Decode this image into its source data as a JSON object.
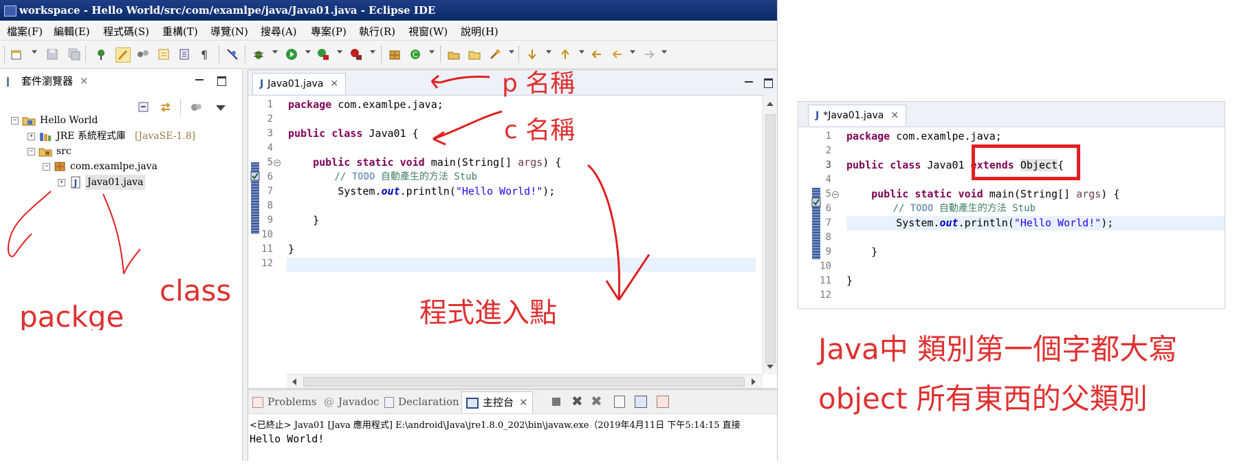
{
  "window": {
    "title": "workspace - Hello World/src/com/examlpe/java/Java01.java - Eclipse IDE"
  },
  "menu": [
    "檔案(F)",
    "編輯(E)",
    "程式碼(S)",
    "重構(T)",
    "導覽(N)",
    "搜尋(A)",
    "專案(P)",
    "執行(R)",
    "視窗(W)",
    "說明(H)"
  ],
  "package_explorer": {
    "title": "套件瀏覽器",
    "tree": [
      {
        "label": "Hello World",
        "suffix": ""
      },
      {
        "label": "JRE 系統程式庫",
        "suffix": "[JavaSE-1.8]"
      },
      {
        "label": "src",
        "suffix": ""
      },
      {
        "label": "com.examlpe.java",
        "suffix": ""
      },
      {
        "label": "Java01.java",
        "suffix": ""
      }
    ]
  },
  "editor": {
    "tab_label": "Java01.java",
    "line_numbers": [
      "1",
      "2",
      "3",
      "4",
      "5",
      "6",
      "7",
      "8",
      "9",
      "10",
      "11",
      "12"
    ],
    "line1": {
      "kw": "package",
      "rest": " com.examlpe.java;"
    },
    "line3": {
      "kw1": "public",
      "kw2": "class",
      "rest": " Java01 {"
    },
    "line5": {
      "kw1": "public",
      "kw2": "static",
      "kw3": "void",
      "sig": " main(String[] ",
      "param": "args",
      "end": ") {"
    },
    "line6": {
      "slashes": "// ",
      "todo": "TODO",
      "text": " 自動產生的方法 Stub"
    },
    "line7": {
      "pre": "System.",
      "field": "out",
      "mid": ".println(",
      "str": "\"Hello World!\"",
      "end": ");"
    },
    "line9": "}",
    "line11": "}"
  },
  "console": {
    "tabs": [
      "Problems",
      "Javadoc",
      "Declaration",
      "主控台"
    ],
    "terminated_line": "<已終止> Java01 [Java 應用程式] E:\\android\\Java\\jre1.8.0_202\\bin\\javaw.exe（2019年4月11日 下午5:14:15 直接",
    "output": "Hello World!"
  },
  "right_editor": {
    "tab_label": "*Java01.java",
    "line3_extends": "extends",
    "line3_object": "Object",
    "line3_brace": "{"
  },
  "annotations": {
    "p_name": "p 名稱",
    "c_name": "c 名稱",
    "entry_point": "程式進入點",
    "class_label": "class",
    "package_label": "packge",
    "uppercase_note": "Java中 類別第一個字都大寫",
    "object_note": "object 所有東西的父類別"
  },
  "colors": {
    "annotation_red": "#e03030",
    "keyword": "#7f0055",
    "comment": "#3f7f5f",
    "string": "#2a00ff",
    "title_bar": "#0b2a6a"
  }
}
